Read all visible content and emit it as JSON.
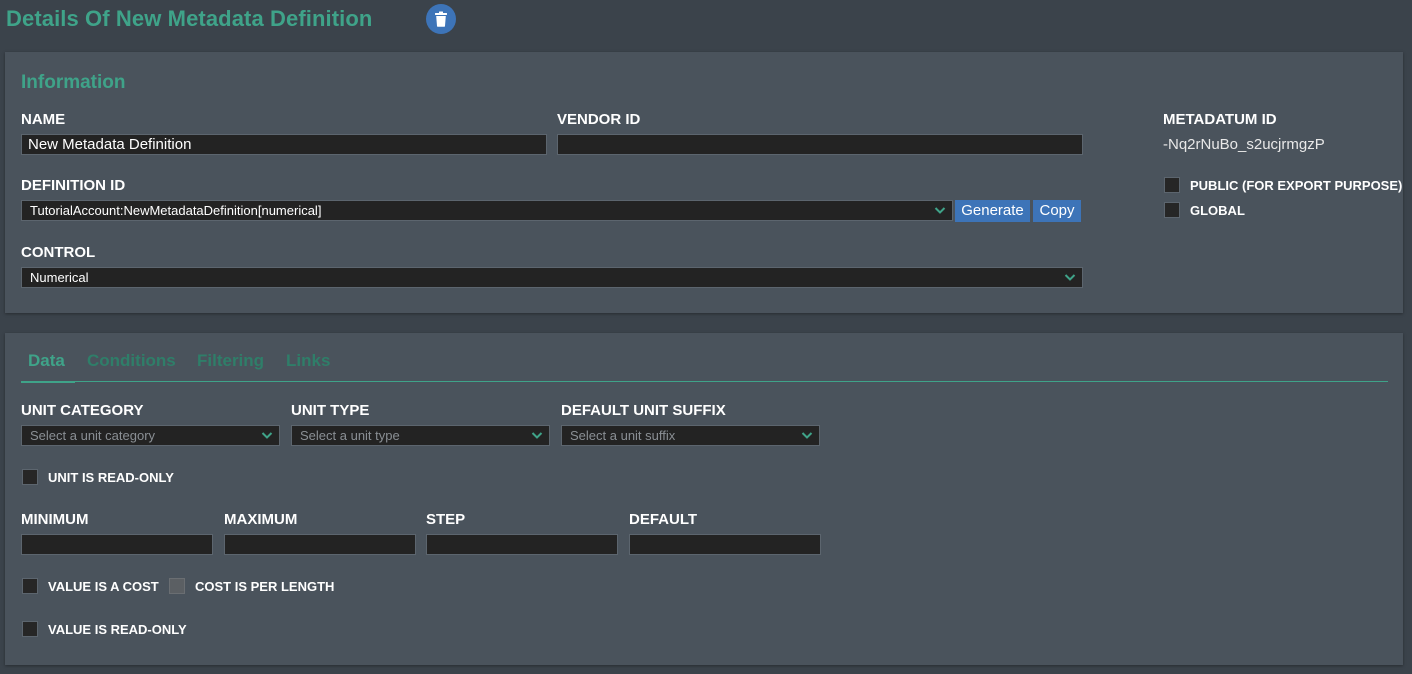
{
  "header": {
    "title": "Details Of New Metadata Definition",
    "delete_icon": "trash-icon"
  },
  "information": {
    "section_title": "Information",
    "name_label": "NAME",
    "name_value": "New Metadata Definition",
    "vendor_id_label": "VENDOR ID",
    "vendor_id_value": "",
    "definition_id_label": "DEFINITION ID",
    "definition_id_value": "TutorialAccount:NewMetadataDefinition[numerical]",
    "generate_label": "Generate",
    "copy_label": "Copy",
    "control_label": "CONTROL",
    "control_value": "Numerical",
    "metadatum_id_label": "METADATUM ID",
    "metadatum_id_value": "-Nq2rNuBo_s2ucjrmgzP",
    "public_label": "PUBLIC (FOR EXPORT PURPOSE)",
    "public_checked": false,
    "global_label": "GLOBAL",
    "global_checked": false
  },
  "tabs": [
    {
      "label": "Data",
      "active": true
    },
    {
      "label": "Conditions",
      "active": false
    },
    {
      "label": "Filtering",
      "active": false
    },
    {
      "label": "Links",
      "active": false
    }
  ],
  "data_tab": {
    "unit_category_label": "UNIT CATEGORY",
    "unit_category_placeholder": "Select a unit category",
    "unit_type_label": "UNIT TYPE",
    "unit_type_placeholder": "Select a unit type",
    "default_unit_suffix_label": "DEFAULT UNIT SUFFIX",
    "default_unit_suffix_placeholder": "Select a unit suffix",
    "unit_read_only_label": "UNIT IS READ-ONLY",
    "minimum_label": "MINIMUM",
    "maximum_label": "MAXIMUM",
    "step_label": "STEP",
    "default_label": "DEFAULT",
    "minimum_value": "",
    "maximum_value": "",
    "step_value": "",
    "default_value": "",
    "value_is_cost_label": "VALUE IS A COST",
    "cost_per_length_label": "COST IS PER LENGTH",
    "value_read_only_label": "VALUE IS READ-ONLY"
  },
  "colors": {
    "accent": "#3fa389",
    "button_blue": "#3d74b8",
    "panel_bg": "#4a535c",
    "page_bg": "#3b434b",
    "field_bg": "#232323"
  }
}
